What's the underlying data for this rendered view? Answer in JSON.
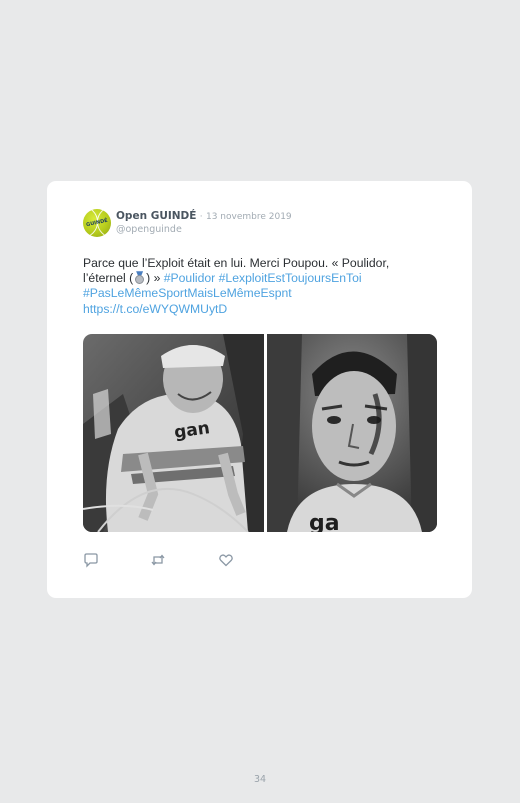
{
  "tweet": {
    "author_name": "Open GUINDÉ",
    "separator": "·",
    "date": "13 novembre 2019",
    "handle": "@openguinde",
    "avatar_label": "GUINDÉ",
    "text_line1": "Parce que l’Exploit était en lui. Merci Poupou. « Poulidor,",
    "text_line2_start": "l’éternel (",
    "text_line2_end": ") »",
    "hashtag_poulidor": "#Poulidor",
    "hashtag_exploit": "#LexploitEstToujoursEnToi",
    "hashtag_sport": "#PasLeMêmeSportMaisLeMêmeEspnt",
    "link": "https://t.co/eWYQWMUytD",
    "medal_icon": "second-place-medal-icon",
    "link_color": "#4fa3e0"
  },
  "media": {
    "left_photo_jersey_text": "gan",
    "right_photo_jersey_text": "ga"
  },
  "actions": {
    "reply_icon": "reply-icon",
    "retweet_icon": "retweet-icon",
    "like_icon": "heart-icon"
  },
  "page": {
    "number": "34"
  }
}
